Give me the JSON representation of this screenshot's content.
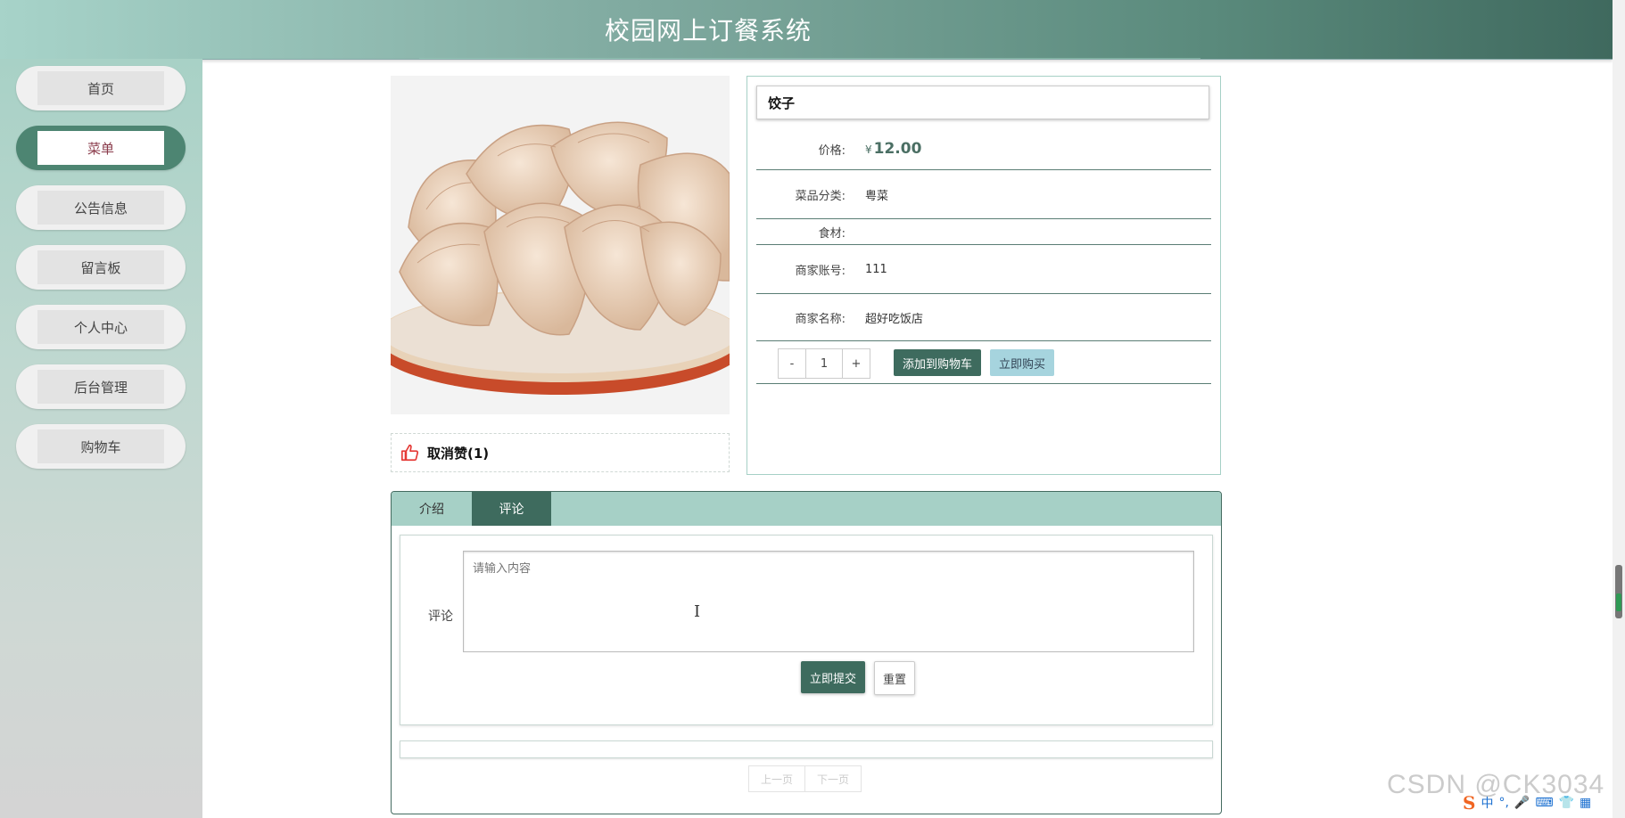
{
  "app": {
    "title": "校园网上订餐系统"
  },
  "sidebar": {
    "items": [
      {
        "label": "首页",
        "active": false
      },
      {
        "label": "菜单",
        "active": true
      },
      {
        "label": "公告信息",
        "active": false
      },
      {
        "label": "留言板",
        "active": false
      },
      {
        "label": "个人中心",
        "active": false
      },
      {
        "label": "后台管理",
        "active": false
      },
      {
        "label": "购物车",
        "active": false
      }
    ]
  },
  "product": {
    "name": "饺子",
    "price_label": "价格:",
    "currency": "¥",
    "price": "12.00",
    "category_label": "菜品分类:",
    "category": "粤菜",
    "ingredients_label": "食材:",
    "ingredients": "",
    "merchant_account_label": "商家账号:",
    "merchant_account": "111",
    "merchant_name_label": "商家名称:",
    "merchant_name": "超好吃饭店",
    "quantity": "1",
    "minus_label": "-",
    "plus_label": "+",
    "add_to_cart_label": "添加到购物车",
    "buy_now_label": "立即购买",
    "like_label": "取消赞(1)"
  },
  "tabs": [
    {
      "label": "介绍",
      "active": false
    },
    {
      "label": "评论",
      "active": true
    }
  ],
  "comment_form": {
    "label": "评论",
    "placeholder": "请输入内容",
    "value": "",
    "submit_label": "立即提交",
    "reset_label": "重置"
  },
  "pager": {
    "prev_label": "上一页",
    "next_label": "下一页"
  },
  "watermark": "CSDN @CK3034",
  "ime": {
    "mode": "中",
    "punct": "°,"
  },
  "colors": {
    "accent": "#3e6b5e",
    "tab_bar": "#a6d0c6",
    "active_nav_text": "#8a3b4b"
  }
}
